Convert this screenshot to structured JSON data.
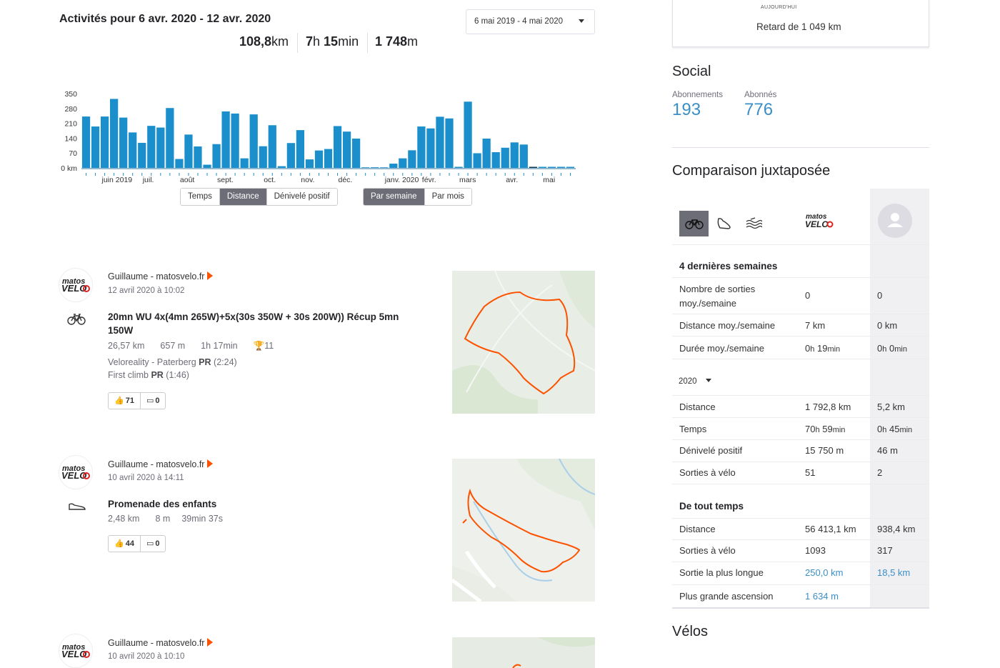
{
  "summary": {
    "title": "Activités pour 6 avr. 2020 - 12 avr. 2020",
    "range_select": "6 mai 2019 - 4 mai 2020",
    "distance_value": "108,8",
    "distance_unit": "km",
    "time_h": "7",
    "time_h_unit": "h",
    "time_min": "15",
    "time_min_unit": "min",
    "elev_value": "1 748",
    "elev_unit": "m"
  },
  "chart_data": {
    "type": "bar",
    "title": "",
    "ylabel": "",
    "y_unit": "km",
    "yticks": [
      "0 km",
      "70",
      "140",
      "210",
      "280",
      "350"
    ],
    "ylim": [
      0,
      350
    ],
    "xtick_labels": [
      "juin 2019",
      "juil.",
      "août",
      "sept.",
      "oct.",
      "nov.",
      "déc.",
      "janv. 2020",
      "févr.",
      "mars",
      "avr.",
      "mai"
    ],
    "bar_color": "#1a8fcb",
    "highlight_color": "#0b3550",
    "highlight_index": 48,
    "values": [
      242,
      195,
      242,
      325,
      237,
      167,
      118,
      198,
      190,
      282,
      42,
      157,
      101,
      15,
      112,
      266,
      256,
      45,
      252,
      102,
      201,
      8,
      117,
      178,
      40,
      82,
      89,
      197,
      171,
      138,
      0,
      3,
      0,
      20,
      45,
      83,
      195,
      186,
      241,
      233,
      5,
      312,
      69,
      138,
      74,
      95,
      120,
      110,
      5,
      5,
      5,
      5,
      5
    ]
  },
  "chart_toggles": {
    "metric": [
      "Temps",
      "Distance",
      "Dénivelé positif"
    ],
    "metric_active": "Distance",
    "period": [
      "Par semaine",
      "Par mois"
    ],
    "period_active": "Par semaine"
  },
  "feed": [
    {
      "athlete": "Guillaume - matosvelo.fr",
      "date": "12 avril 2020 à 10:02",
      "sport_icon": "bike-icon",
      "title": "20mn WU 4x(4mn 265W)+5x(30s 350W + 30s 200W)) Récup 5mn 150W",
      "distance": "26,57 km",
      "elevation": "657 m",
      "duration": "1h 17min",
      "achievements": "11",
      "segments": [
        {
          "name": "Velo­reality - Paterberg",
          "badge": "PR",
          "time": "(2:24)"
        },
        {
          "name": "First climb",
          "badge": "PR",
          "time": "(1:46)"
        }
      ],
      "kudos": "71",
      "comments": "0"
    },
    {
      "athlete": "Guillaume - matosvelo.fr",
      "date": "10 avril 2020 à 14:11",
      "sport_icon": "shoe-icon",
      "title": "Promenade des enfants",
      "distance": "2,48 km",
      "elevation": "8 m",
      "duration": "39min 37s",
      "kudos": "44",
      "comments": "0"
    },
    {
      "athlete": "Guillaume - matosvelo.fr",
      "date": "10 avril 2020 à 10:10"
    }
  ],
  "right": {
    "goal_today": "AUJOURD'HUI",
    "goal_behind": "Retard de 1 049 km",
    "social_title": "Social",
    "following_label": "Abonnements",
    "following_value": "193",
    "followers_label": "Abonnés",
    "followers_value": "776",
    "comparison_title": "Comparaison juxtaposée",
    "last4_title": "4 dernières semaines",
    "last4": [
      {
        "label": "Nombre de sorties moy./semaine",
        "v1": "0",
        "v2": "0"
      },
      {
        "label": "Distance moy./semaine",
        "v1": "7 km",
        "v2": "0 km"
      },
      {
        "label": "Durée moy./semaine",
        "v1_h": "0",
        "v1_m": "19",
        "v2_h": "0",
        "v2_m": "0"
      }
    ],
    "year_select": "2020",
    "year_rows": [
      {
        "label": "Distance",
        "v1": "1 792,8 km",
        "v2": "5,2 km"
      },
      {
        "label": "Temps",
        "v1_h": "70",
        "v1_m": "59",
        "v2_h": "0",
        "v2_m": "45"
      },
      {
        "label": "Dénivelé positif",
        "v1": "15 750 m",
        "v2": "46 m"
      },
      {
        "label": "Sorties à vélo",
        "v1": "51",
        "v2": "2"
      }
    ],
    "alltime_title": "De tout temps",
    "alltime_rows": [
      {
        "label": "Distance",
        "v1": "56 413,1 km",
        "v2": "938,4 km"
      },
      {
        "label": "Sorties à vélo",
        "v1": "1093",
        "v2": "317"
      },
      {
        "label": "Sortie la plus longue",
        "v1": "250,0 km",
        "v2": "18,5 km"
      },
      {
        "label": "Plus grande ascension",
        "v1": "1 634 m",
        "v2": ""
      }
    ],
    "h_unit": "h",
    "min_unit": "min",
    "bikes_title": "Vélos"
  }
}
